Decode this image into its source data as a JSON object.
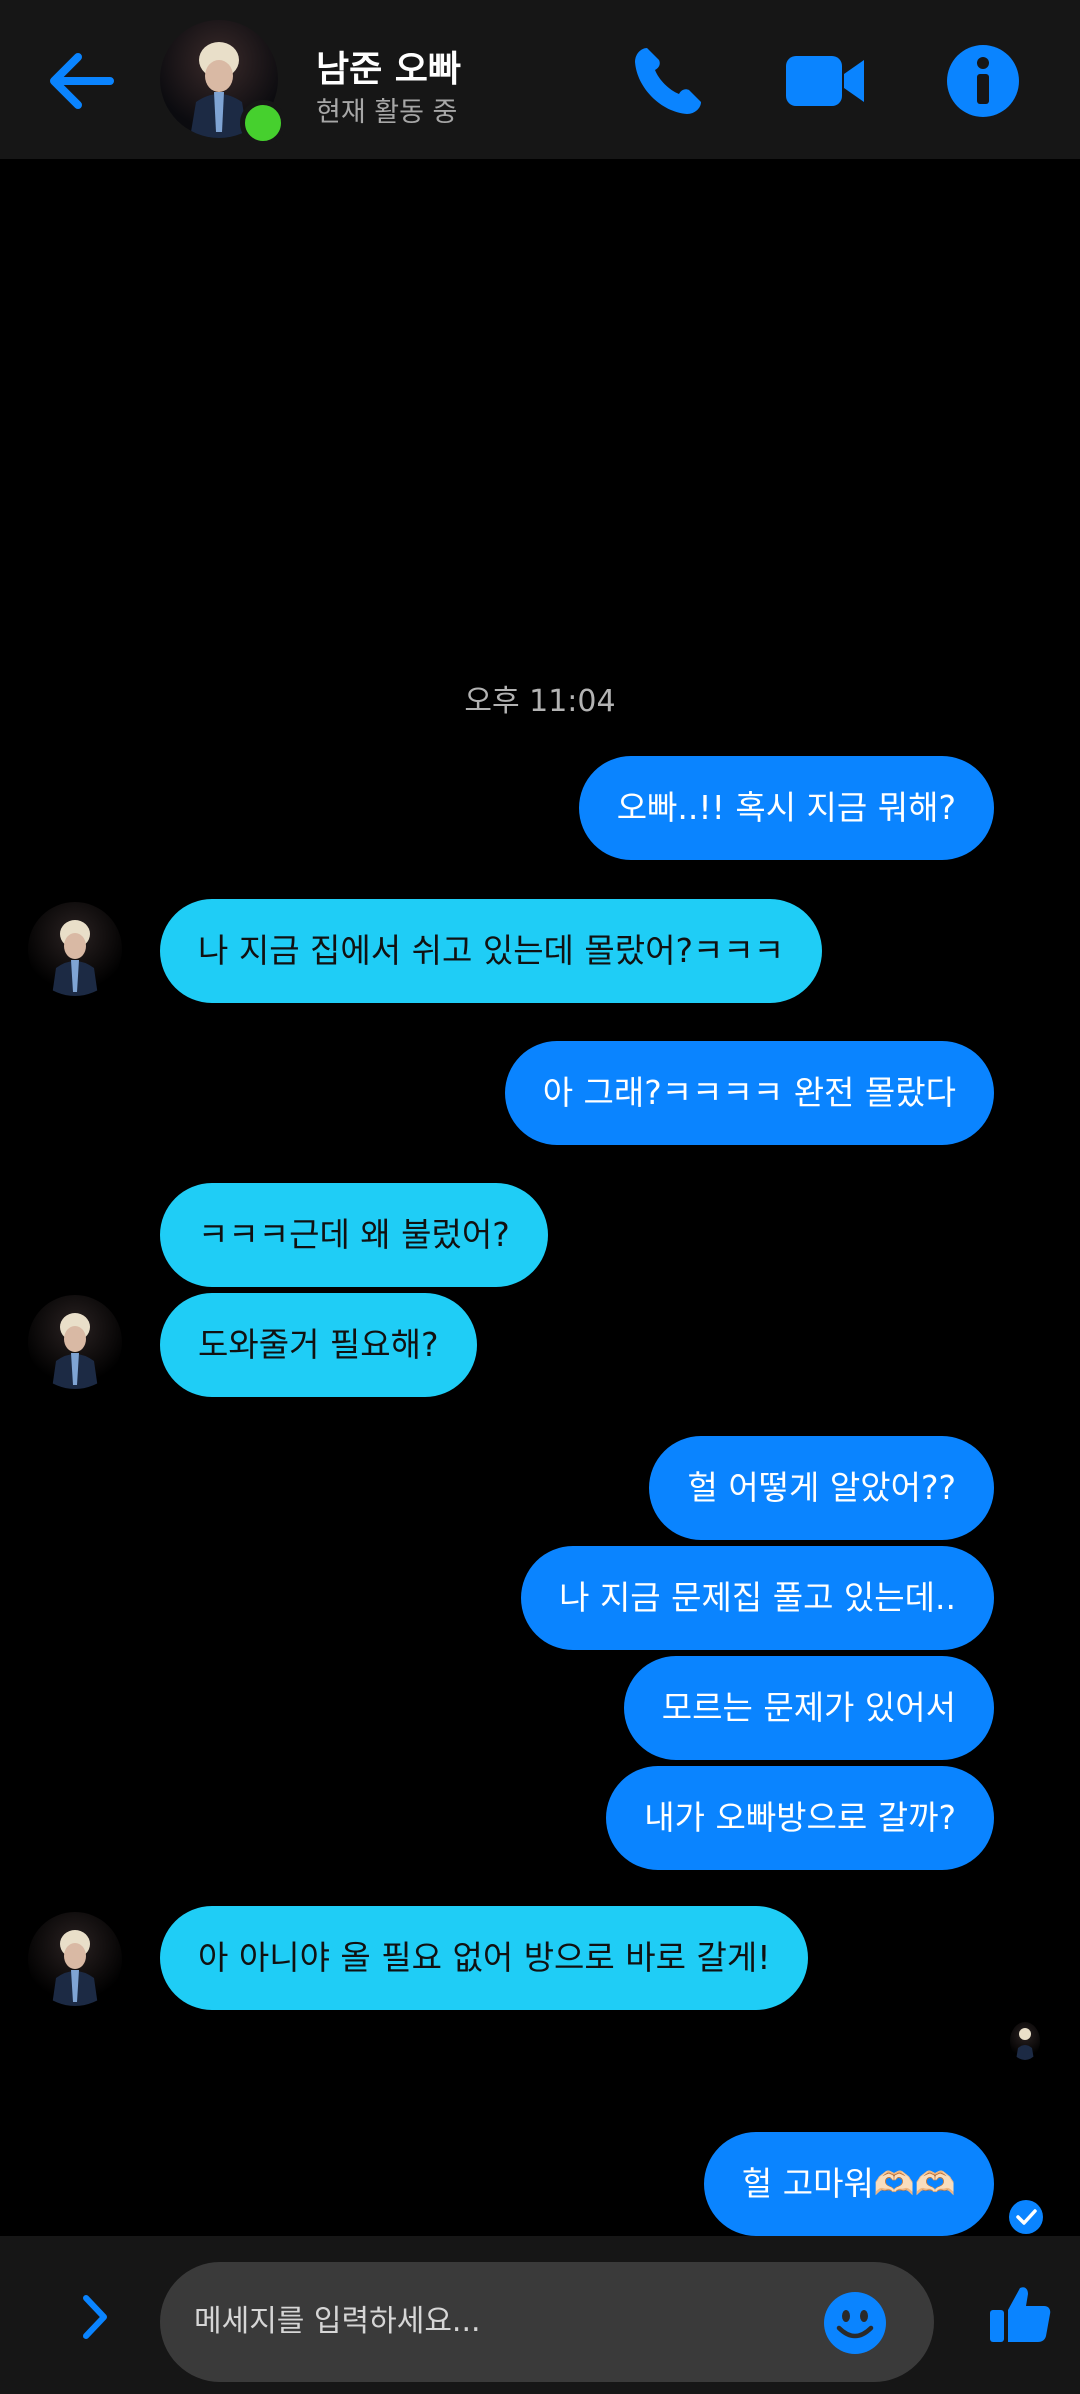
{
  "header": {
    "contact_name": "남준 오빠",
    "status": "현재 활동 중"
  },
  "chat": {
    "timestamp": "오후 11:04",
    "messages": [
      {
        "from": "me",
        "text": "오빠..!! 혹시 지금 뭐해?"
      },
      {
        "from": "them",
        "text": "나 지금 집에서 쉬고 있는데 몰랐어?ㅋㅋㅋ"
      },
      {
        "from": "me",
        "text": "아 그래?ㅋㅋㅋㅋ 완전 몰랐다"
      },
      {
        "from": "them",
        "text": "ㅋㅋㅋ근데 왜 불렀어?"
      },
      {
        "from": "them",
        "text": "도와줄거 필요해?"
      },
      {
        "from": "me",
        "text": "헐 어떻게 알았어??"
      },
      {
        "from": "me",
        "text": "나 지금 문제집 풀고 있는데.."
      },
      {
        "from": "me",
        "text": "모르는 문제가 있어서"
      },
      {
        "from": "me",
        "text": "내가 오빠방으로 갈까?"
      },
      {
        "from": "them",
        "text": "아 아니야 올 필요 없어 방으로 바로 갈게!"
      },
      {
        "from": "me",
        "text": "헐 고마워🫶🏻🫶🏻"
      }
    ]
  },
  "composer": {
    "placeholder": "메세지를 입력하세요..."
  },
  "icons": {
    "back": "arrow-left-icon",
    "call": "phone-icon",
    "video": "video-camera-icon",
    "info": "info-icon",
    "expand": "chevron-right-icon",
    "emoji": "smiley-icon",
    "like": "thumbs-up-icon"
  },
  "colors": {
    "accent": "#0a84ff",
    "sent_bubble": "#0a84ff",
    "received_bubble": "#1fcdf6",
    "online": "#46d02e",
    "bar_bg": "#161616"
  }
}
